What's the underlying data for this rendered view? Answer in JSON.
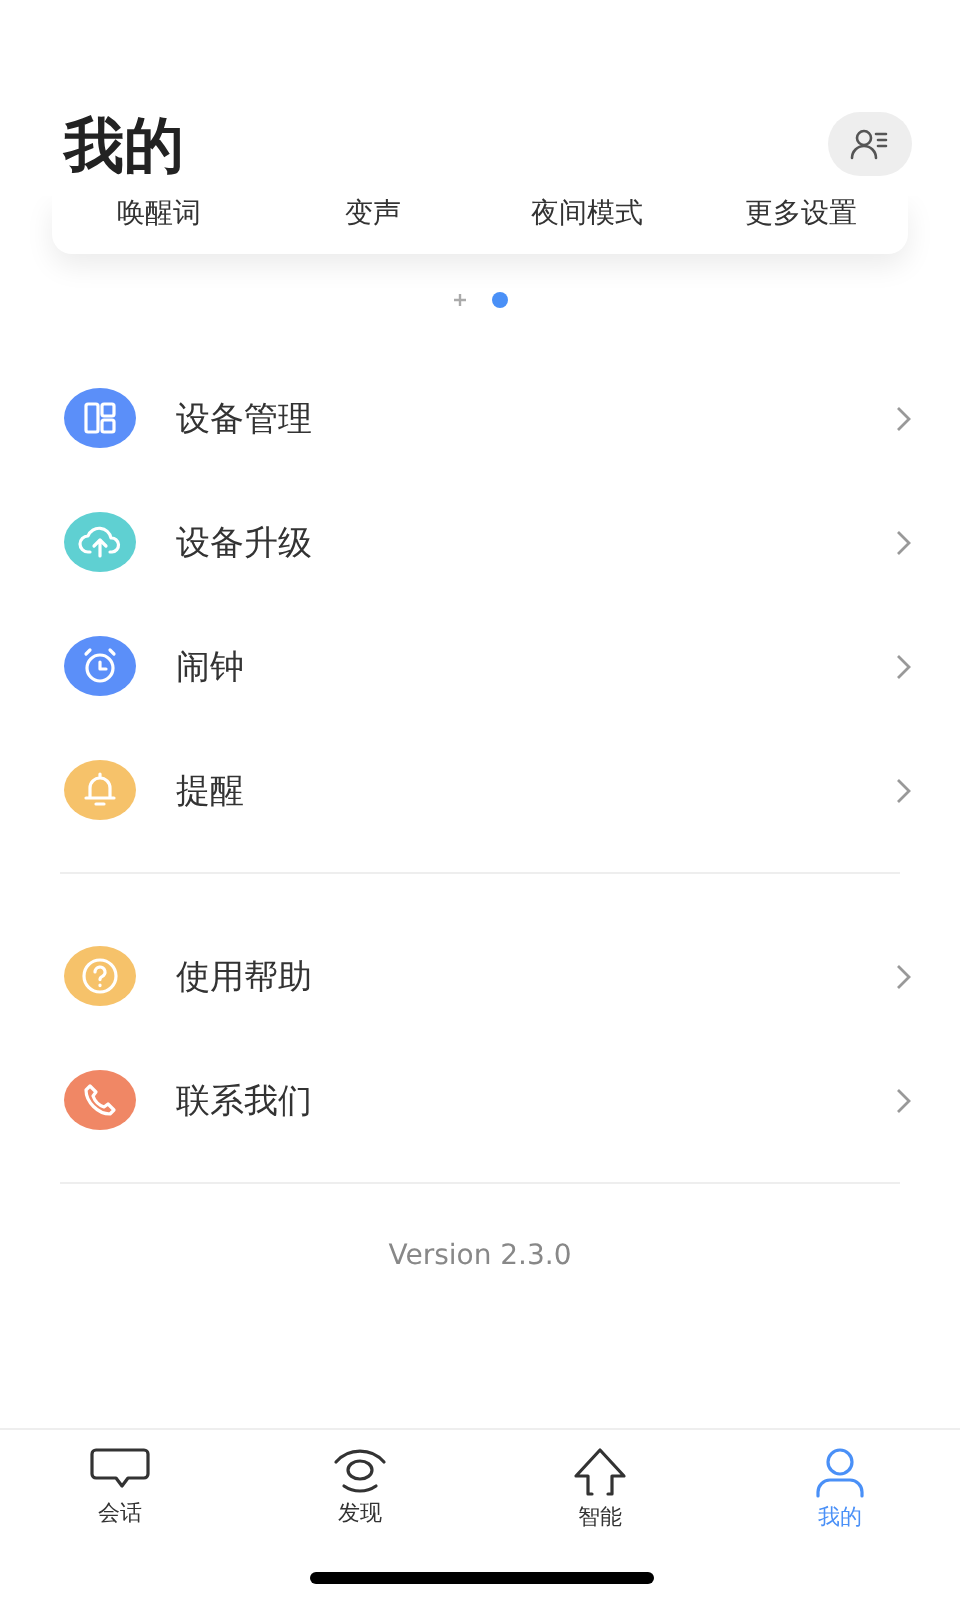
{
  "header": {
    "title": "我的"
  },
  "quick_settings": [
    {
      "label": "唤醒词"
    },
    {
      "label": "变声"
    },
    {
      "label": "夜间模式"
    },
    {
      "label": "更多设置"
    }
  ],
  "pager": [
    {
      "selected": false
    },
    {
      "selected": true
    }
  ],
  "menu_groups": [
    {
      "items": [
        {
          "kind": "devices",
          "label": "设备管理",
          "color": "#5b8ff9"
        },
        {
          "kind": "upgrade",
          "label": "设备升级",
          "color": "#5fd0d2"
        },
        {
          "kind": "alarm",
          "label": "闹钟",
          "color": "#5b8ff9"
        },
        {
          "kind": "reminder",
          "label": "提醒",
          "color": "#f6c26a"
        }
      ]
    },
    {
      "items": [
        {
          "kind": "help",
          "label": "使用帮助",
          "color": "#f6c26a"
        },
        {
          "kind": "contact",
          "label": "联系我们",
          "color": "#f08765"
        }
      ]
    }
  ],
  "version": "Version 2.3.0",
  "tabs": [
    {
      "kind": "chat",
      "label": "会话",
      "selected": false
    },
    {
      "kind": "discover",
      "label": "发现",
      "selected": false
    },
    {
      "kind": "smart",
      "label": "智能",
      "selected": false
    },
    {
      "kind": "me",
      "label": "我的",
      "selected": true
    }
  ]
}
